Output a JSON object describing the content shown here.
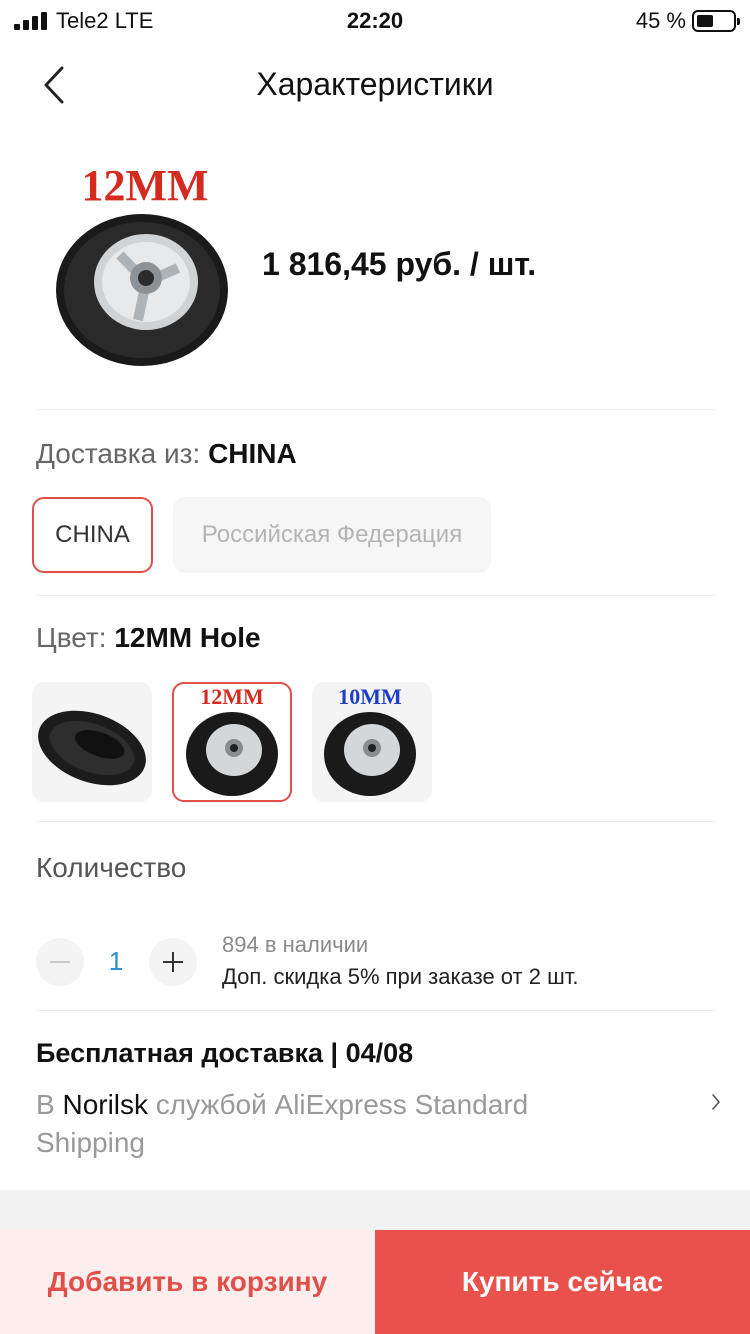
{
  "status_bar": {
    "carrier": "Tele2  LTE",
    "time": "22:20",
    "battery_percent": "45 %"
  },
  "header": {
    "title": "Характеристики",
    "back_icon": "chevron-left-icon"
  },
  "product": {
    "image_label": "12MM",
    "price": "1 816,45 руб. / шт."
  },
  "shipping_from": {
    "label": "Доставка из: ",
    "value": "CHINA",
    "options": [
      {
        "label": "CHINA",
        "state": "selected"
      },
      {
        "label": "Российская Федерация",
        "state": "disabled"
      }
    ]
  },
  "color": {
    "label": "Цвет: ",
    "value": "12MM Hole",
    "swatches": [
      {
        "name": "tire-only",
        "caption": "",
        "selected": false
      },
      {
        "name": "12mm",
        "caption": "12MM",
        "caption_color": "#d42a1f",
        "selected": true
      },
      {
        "name": "10mm",
        "caption": "10MM",
        "caption_color": "#1f3fc7",
        "selected": false
      }
    ]
  },
  "quantity": {
    "label": "Количество",
    "value": "1",
    "stock": "894 в наличии",
    "discount": "Доп. скидка 5% при заказе от 2 шт."
  },
  "delivery": {
    "title": "Бесплатная доставка | 04/08",
    "prefix": "В ",
    "city": "Norilsk",
    "service": " службой AliExpress Standard Shipping"
  },
  "actions": {
    "add_to_cart": "Добавить в корзину",
    "buy_now": "Купить сейчас"
  },
  "colors": {
    "accent": "#e9524c",
    "accent_light": "#fdeeee",
    "link_blue": "#2b8fd6"
  }
}
